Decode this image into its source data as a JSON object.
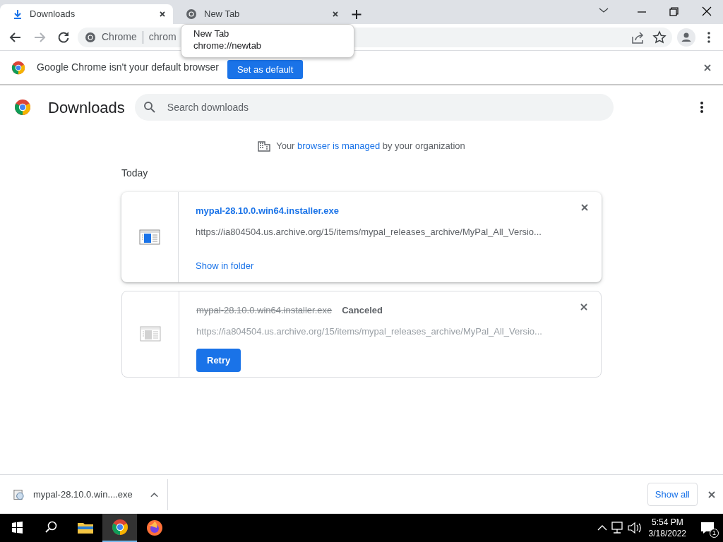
{
  "tabs": [
    {
      "kind": "download",
      "title": "Downloads",
      "selected": true
    },
    {
      "kind": "chrome",
      "title": "New Tab",
      "selected": false
    }
  ],
  "toolbar": {
    "site_label": "Chrome",
    "url": "chrom"
  },
  "tooltip": {
    "title": "New Tab",
    "url": "chrome://newtab"
  },
  "infobar": {
    "message": "Google Chrome isn't your default browser",
    "button": "Set as default"
  },
  "page": {
    "title": "Downloads",
    "search_placeholder": "Search downloads",
    "managed": {
      "before": "Your",
      "link": "browser is managed",
      "after": "by your organization"
    },
    "section": "Today",
    "downloads": [
      {
        "filename": "mypal-28.10.0.win64.installer.exe",
        "canceled": false,
        "url": "https://ia804504.us.archive.org/15/items/mypal_releases_archive/MyPal_All_Versio...",
        "action": {
          "kind": "link",
          "label": "Show in folder"
        }
      },
      {
        "filename": "mypal-28.10.0.win64.installer.exe",
        "canceled": true,
        "status": "Canceled",
        "url": "https://ia804504.us.archive.org/15/items/mypal_releases_archive/MyPal_All_Versio...",
        "action": {
          "kind": "button",
          "label": "Retry"
        }
      }
    ]
  },
  "shelf": {
    "item": "mypal-28.10.0.win....exe",
    "button": "Show all"
  },
  "taskbar": {
    "apps": [
      {
        "kind": "explorer",
        "selected": false
      },
      {
        "kind": "chrome",
        "selected": true
      },
      {
        "kind": "firefox",
        "selected": false
      }
    ],
    "time": "5:54 PM",
    "date": "3/18/2022",
    "notifications": "1"
  }
}
